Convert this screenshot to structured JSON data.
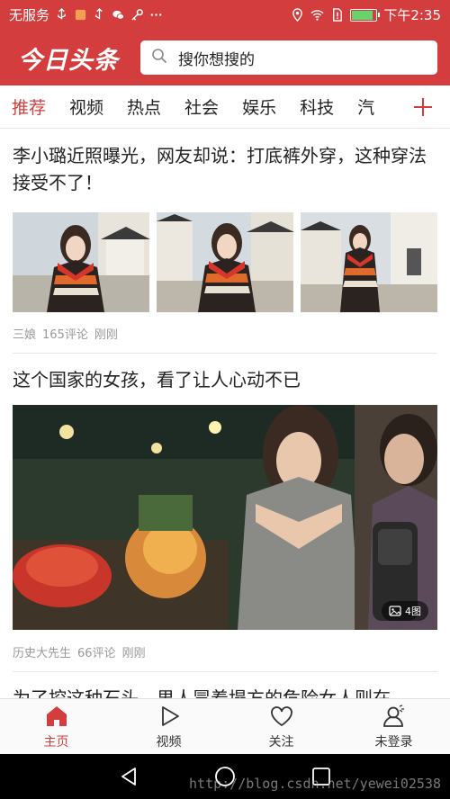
{
  "status_bar": {
    "carrier": "无服务",
    "time": "下午2:35"
  },
  "header": {
    "logo": "今日头条",
    "search_placeholder": "搜你想搜的"
  },
  "channels": [
    {
      "label": "推荐",
      "active": true
    },
    {
      "label": "视频",
      "active": false
    },
    {
      "label": "热点",
      "active": false
    },
    {
      "label": "社会",
      "active": false
    },
    {
      "label": "娱乐",
      "active": false
    },
    {
      "label": "科技",
      "active": false
    },
    {
      "label": "汽",
      "active": false
    }
  ],
  "articles": [
    {
      "title": "李小璐近照曝光，网友却说：打底裤外穿，这种穿法接受不了！",
      "source": "三娘",
      "comments": "165评论",
      "time": "刚刚"
    },
    {
      "title": "这个国家的女孩，看了让人心动不已",
      "image_count": "4图",
      "source": "历史大先生",
      "comments": "66评论",
      "time": "刚刚"
    },
    {
      "title": "为了挖这种石头，男人冒着塌方的危险女人则在"
    }
  ],
  "tabbar": [
    {
      "label": "主页",
      "icon": "home-icon",
      "active": true
    },
    {
      "label": "视频",
      "icon": "play-icon",
      "active": false
    },
    {
      "label": "关注",
      "icon": "heart-icon",
      "active": false
    },
    {
      "label": "未登录",
      "icon": "user-icon",
      "active": false
    }
  ],
  "watermark": "http://blog.csdn.net/yewei02538",
  "colors": {
    "brand_red": "#d43d3d",
    "meta_gray": "#999999"
  }
}
